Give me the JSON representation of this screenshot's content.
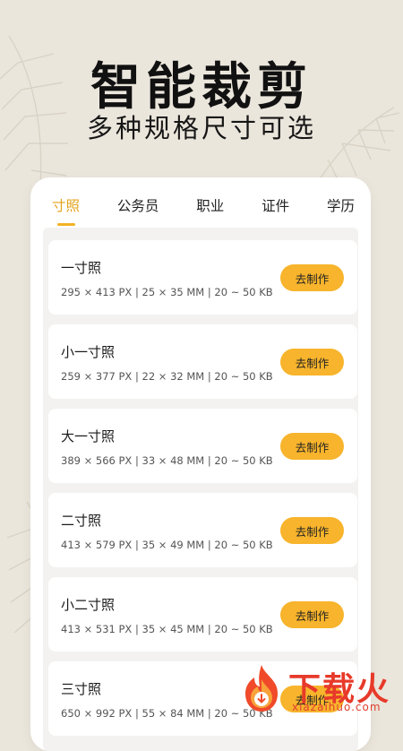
{
  "hero": {
    "title": "智能裁剪",
    "subtitle": "多种规格尺寸可选"
  },
  "tabs": [
    {
      "label": "寸照",
      "active": true
    },
    {
      "label": "公务员",
      "active": false
    },
    {
      "label": "职业",
      "active": false
    },
    {
      "label": "证件",
      "active": false
    },
    {
      "label": "学历",
      "active": false
    }
  ],
  "items": [
    {
      "name": "一寸照",
      "specs": "295 × 413 PX | 25 × 35 MM | 20 ~ 50 KB",
      "button": "去制作"
    },
    {
      "name": "小一寸照",
      "specs": "259 × 377 PX | 22 × 32 MM | 20 ~ 50 KB",
      "button": "去制作"
    },
    {
      "name": "大一寸照",
      "specs": "389 × 566 PX | 33 × 48 MM | 20 ~ 50 KB",
      "button": "去制作"
    },
    {
      "name": "二寸照",
      "specs": "413 × 579 PX | 35 × 49 MM | 20 ~ 50 KB",
      "button": "去制作"
    },
    {
      "name": "小二寸照",
      "specs": "413 × 531 PX | 35 × 45 MM | 20 ~ 50 KB",
      "button": "去制作"
    },
    {
      "name": "三寸照",
      "specs": "650 × 992 PX | 55 × 84 MM | 20 ~ 50 KB",
      "button": "去制作"
    }
  ],
  "watermark": {
    "text": "下载火",
    "url": "xiazaihuo.com",
    "icon": "flame-download-icon"
  },
  "colors": {
    "accent": "#f7b42c",
    "active_tab": "#e3a21a",
    "background": "#ebe6dc",
    "watermark": "#e73a2a"
  }
}
